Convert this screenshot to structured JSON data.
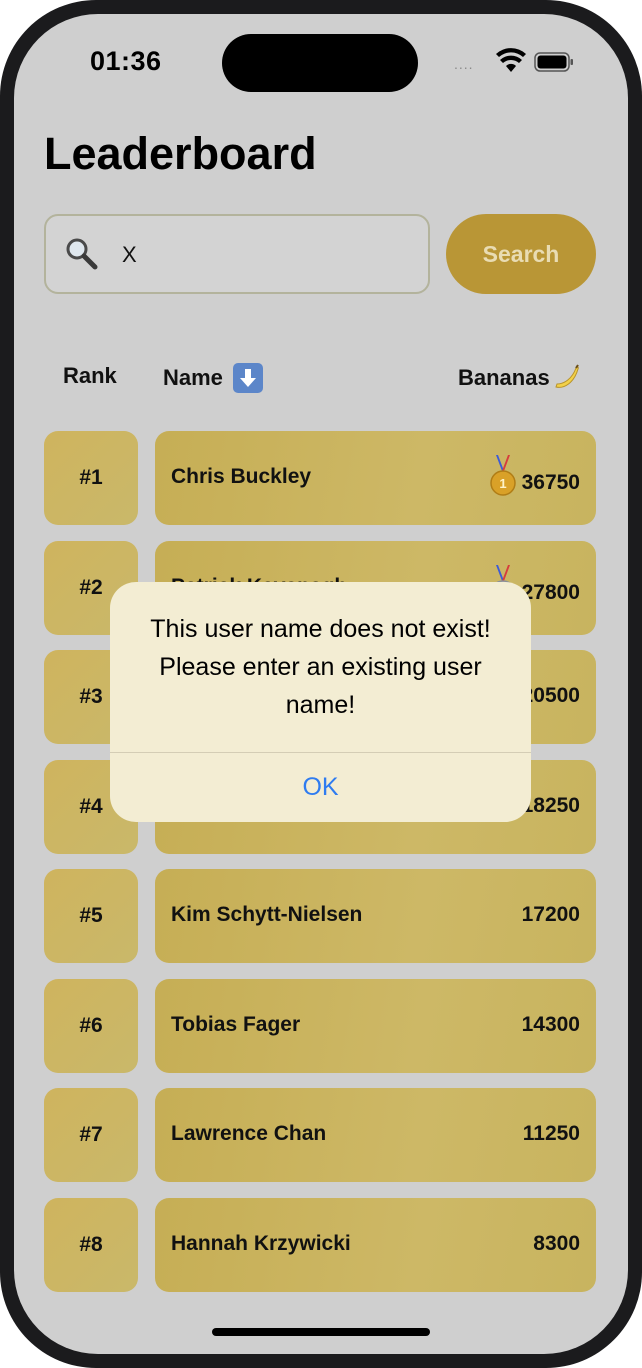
{
  "status_bar": {
    "time": "01:36",
    "signal": "....",
    "wifi_icon": "wifi-icon",
    "battery_icon": "battery-icon"
  },
  "page": {
    "title": "Leaderboard"
  },
  "search": {
    "value": "X",
    "icon": "magnifier-icon",
    "button_label": "Search"
  },
  "columns": {
    "rank": "Rank",
    "name": "Name",
    "name_sort_icon": "arrow-down-icon",
    "bananas": "Bananas",
    "bananas_icon": "banana-icon"
  },
  "rows": [
    {
      "rank": "#1",
      "name": "Chris Buckley",
      "bananas": "36750",
      "medal": "gold-medal-icon"
    },
    {
      "rank": "#2",
      "name": "Patrick Kavanagh",
      "bananas": "27800",
      "medal": "silver-medal-icon"
    },
    {
      "rank": "#3",
      "name": "",
      "bananas": "20500"
    },
    {
      "rank": "#4",
      "name": "",
      "bananas": "18250"
    },
    {
      "rank": "#5",
      "name": "Kim Schytt-Nielsen",
      "bananas": "17200"
    },
    {
      "rank": "#6",
      "name": "Tobias Fager",
      "bananas": "14300"
    },
    {
      "rank": "#7",
      "name": "Lawrence Chan",
      "bananas": "11250"
    },
    {
      "rank": "#8",
      "name": "Hannah Krzywicki",
      "bananas": "8300"
    }
  ],
  "alert": {
    "message": "This user name does not exist! Please enter an existing user name!",
    "ok_label": "OK"
  },
  "colors": {
    "accent_gold": "#b99636",
    "row_gold": "#c9b460",
    "alert_button": "#2f7cf0"
  }
}
